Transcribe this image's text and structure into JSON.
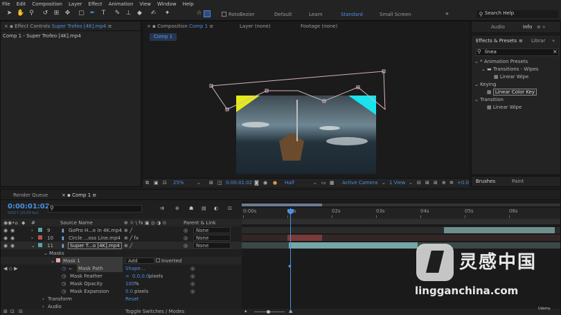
{
  "menu": [
    "File",
    "Edit",
    "Composition",
    "Layer",
    "Effect",
    "Animation",
    "View",
    "Window",
    "Help"
  ],
  "toolbar": {
    "rotobezier": "RotoBezier",
    "workspaces": [
      "Default",
      "Learn",
      "Standard",
      "Small Screen"
    ],
    "active_workspace": "Standard",
    "search_help": "Search Help"
  },
  "effect_controls": {
    "tab_prefix": "Effect Controls",
    "tab_layer": "Super Trofeo [4K].mp4",
    "subtitle": "Comp 1 - Super Trofeo [4K].mp4"
  },
  "viewer": {
    "tab_prefix": "Composition",
    "tab_name": "Comp 1",
    "layer_tab": "Layer (none)",
    "footage_tab": "Footage (none)",
    "comp_chip": "Comp 1",
    "zoom": "25%",
    "timecode": "0:00:01:02",
    "resolution": "Half",
    "camera": "Active Camera",
    "views": "1 View",
    "exposure": "+0.0"
  },
  "right_top": {
    "tabs": [
      "Audio",
      "Info"
    ]
  },
  "effects_presets": {
    "tab": "Effects & Presets",
    "tab2": "Librar",
    "search_value": "linea",
    "items": [
      {
        "label": "* Animation Presets",
        "indent": 0
      },
      {
        "label": "Transitions - Wipes",
        "indent": 1
      },
      {
        "label": "Linear Wipe",
        "indent": 2
      },
      {
        "label": "Keying",
        "indent": 0
      },
      {
        "label": "Linear Color Key",
        "indent": 1,
        "selected": true
      },
      {
        "label": "Transition",
        "indent": 0
      },
      {
        "label": "Linear Wipe",
        "indent": 1
      }
    ]
  },
  "brushes": {
    "tabs": [
      "Brushes",
      "Paint"
    ]
  },
  "timeline": {
    "render_queue_tab": "Render Queue",
    "comp_tab": "Comp 1",
    "current_time": "0:00:01:02",
    "frame_info": "00027 (25.00 fps)",
    "header": {
      "source_name": "Source Name",
      "parent": "Parent & Link"
    },
    "layers": [
      {
        "num": "9",
        "name": "GoPro H...e in 4K.mp4",
        "color": "#5aa3a3",
        "parent": "None"
      },
      {
        "num": "10",
        "name": "Circle ...oss Line.mp4",
        "color": "#c0504d",
        "parent": "None"
      },
      {
        "num": "11",
        "name": "Super T...o [4K].mp4",
        "color": "#5aa3a3",
        "parent": "None"
      }
    ],
    "masks_label": "Masks",
    "mask": {
      "name": "Mask 1",
      "mode": "Add",
      "inverted": "Inverted"
    },
    "mask_props": [
      {
        "name": "Mask Path",
        "value": "Shape..."
      },
      {
        "name": "Mask Feather",
        "value": "0.0,0.0",
        "unit": "pixels"
      },
      {
        "name": "Mask Opacity",
        "value": "100",
        "unit": "%"
      },
      {
        "name": "Mask Expansion",
        "value": "0.0",
        "unit": "pixels"
      }
    ],
    "transform": "Transform",
    "transform_value": "Reset",
    "audio": "Audio",
    "ruler": [
      "0:00s",
      "01s",
      "02s",
      "03s",
      "04s",
      "05s",
      "06s"
    ],
    "toggle_label": "Toggle Switches / Modes"
  },
  "watermark": {
    "cn": "灵感中国",
    "url": "lingganchina.com",
    "udemy": "Udemy"
  },
  "colors": {
    "accent": "#4a90e2",
    "panel": "#232323",
    "bg": "#1d1d1d"
  }
}
